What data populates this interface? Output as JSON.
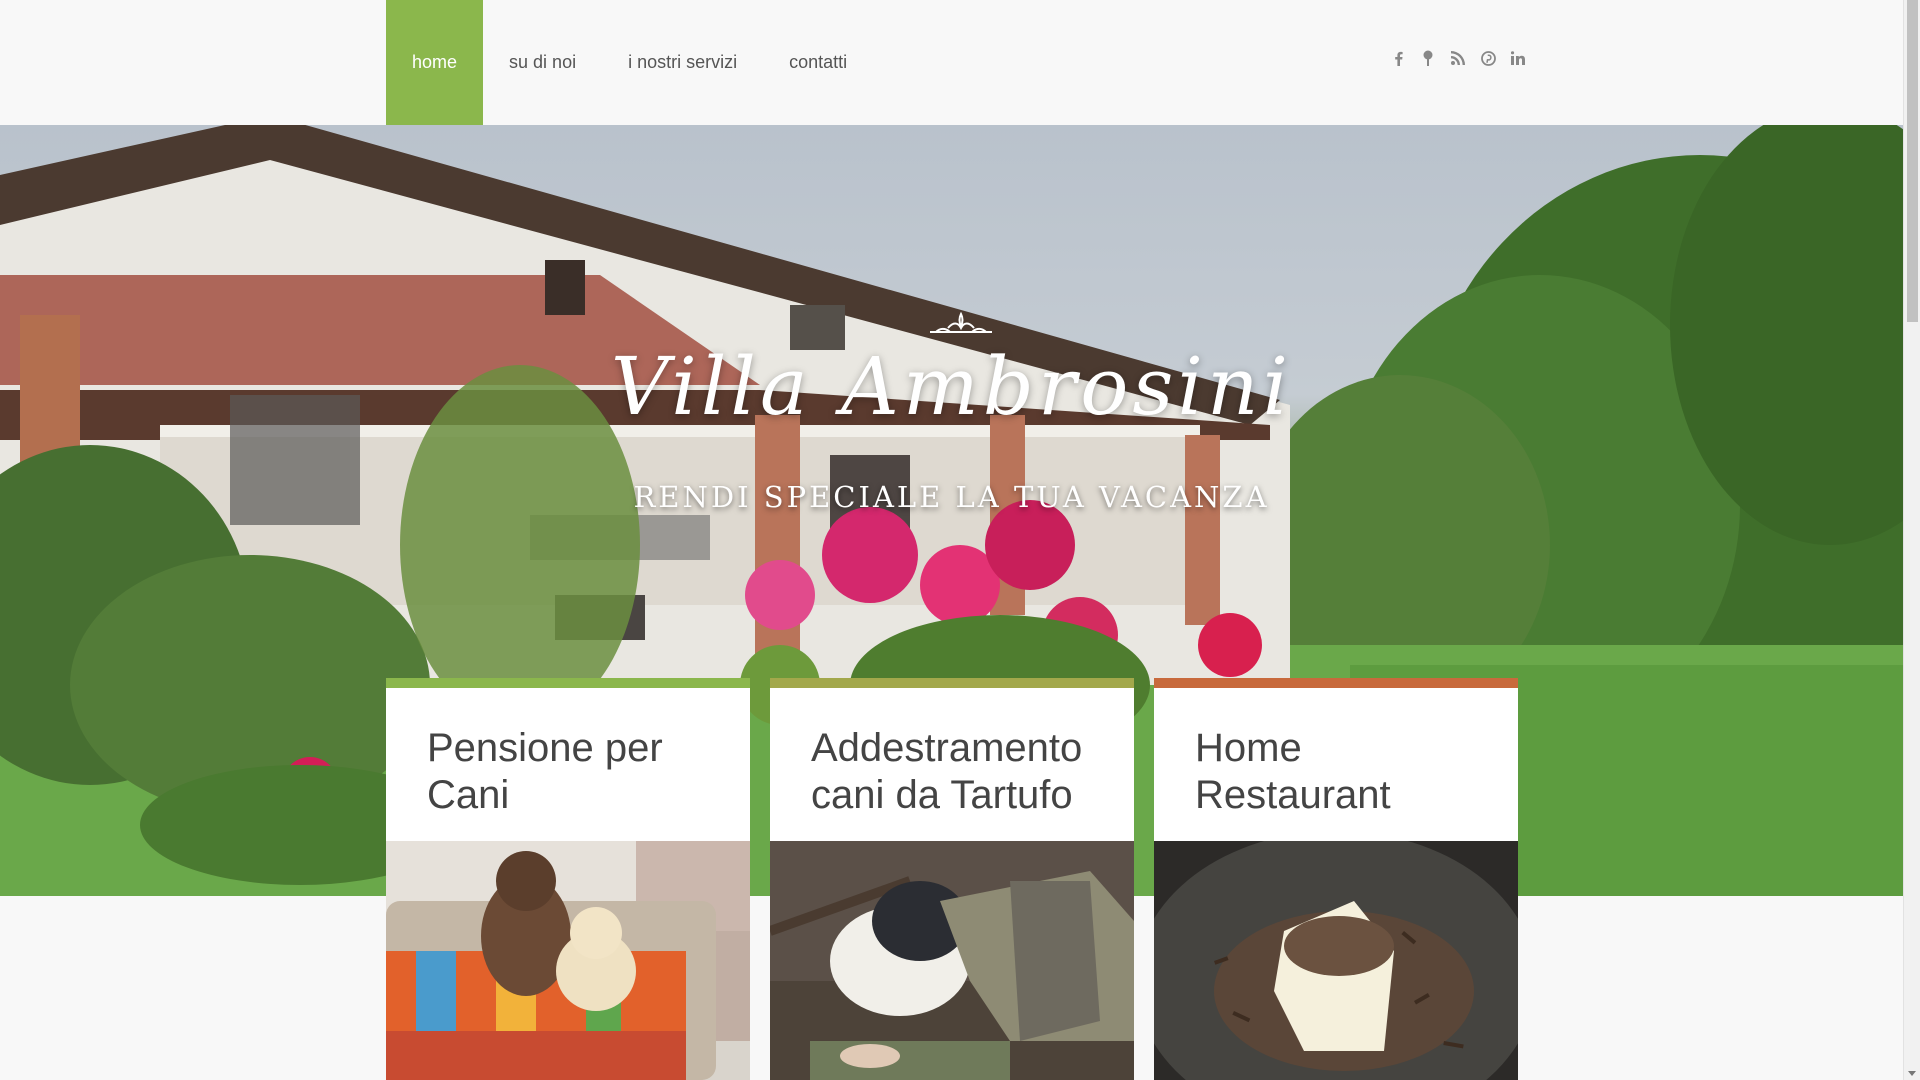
{
  "nav": {
    "items": [
      {
        "label": "home",
        "active": true
      },
      {
        "label": "su di noi",
        "active": false
      },
      {
        "label": "i nostri servizi",
        "active": false
      },
      {
        "label": "contatti",
        "active": false
      }
    ]
  },
  "social": {
    "icons": [
      "facebook-icon",
      "map-pin-icon",
      "rss-icon",
      "pinterest-icon",
      "linkedin-icon"
    ],
    "color": "#888888"
  },
  "hero": {
    "title": "Villa Ambrosini",
    "subtitle": "Rendi speciale la tua vacanza"
  },
  "cards": [
    {
      "title": "Pensione per Cani",
      "accent": "#8bb74c"
    },
    {
      "title": "Addestramento cani da Tartufo",
      "accent": "#a3a84b"
    },
    {
      "title": "Home Restaurant",
      "accent": "#c86a3c"
    }
  ],
  "colors": {
    "accent": "#8bb74c",
    "nav_text": "#555555",
    "background": "#f8f8f8"
  }
}
